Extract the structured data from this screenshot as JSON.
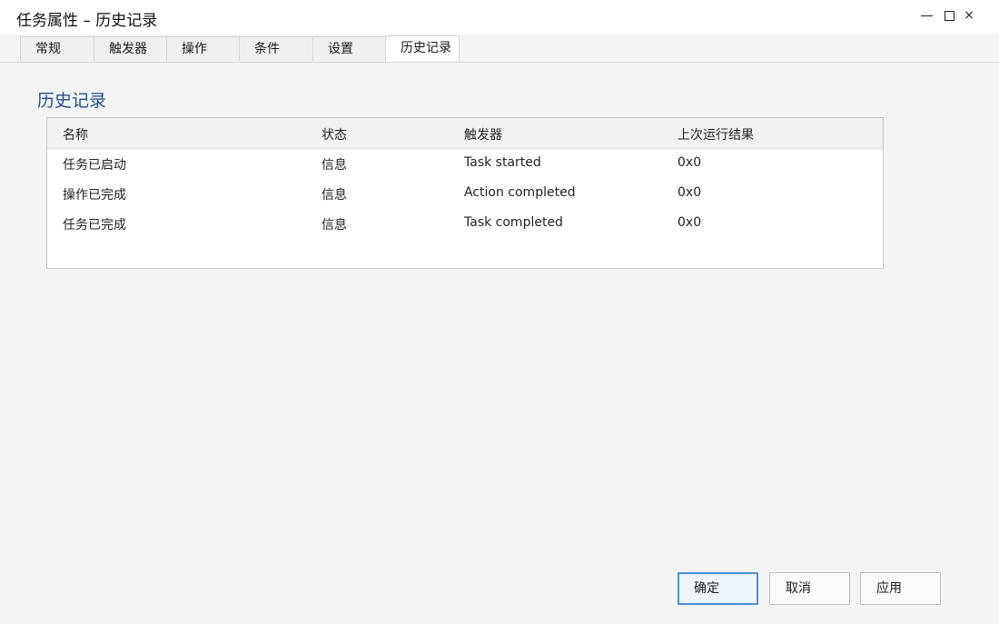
{
  "window": {
    "title": "任务属性 – 历史记录",
    "close_glyph": "×"
  },
  "tabs": [
    {
      "label": "常规"
    },
    {
      "label": "触发器"
    },
    {
      "label": "操作"
    },
    {
      "label": "条件"
    },
    {
      "label": "设置"
    },
    {
      "label": "历史记录",
      "active": true
    }
  ],
  "section": {
    "title": "历史记录"
  },
  "table": {
    "columns": [
      "名称",
      "状态",
      "触发器",
      "上次运行结果"
    ],
    "rows": [
      [
        "任务已启动",
        "信息",
        "Task started",
        "0x0"
      ],
      [
        "操作已完成",
        "信息",
        "Action completed",
        "0x0"
      ],
      [
        "任务已完成",
        "信息",
        "Task completed",
        "0x0"
      ]
    ]
  },
  "buttons": {
    "ok": "确定",
    "cancel": "取消",
    "apply": "应用"
  },
  "colors": {
    "accent": "#1e4f8c",
    "primary_border": "#4f8fd6",
    "background": "#f4f4f4"
  }
}
